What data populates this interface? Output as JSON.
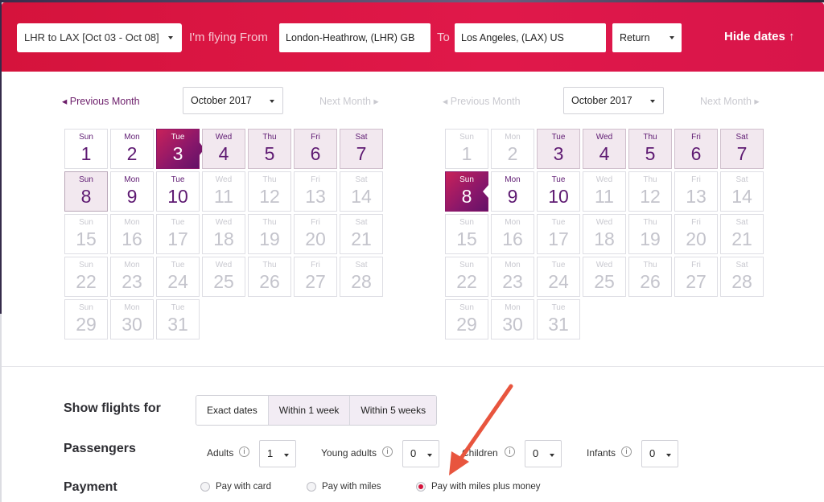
{
  "search_bar": {
    "route_select": "LHR to LAX [Oct 03 - Oct 08]",
    "from_label": "I'm flying From",
    "from_value": "London-Heathrow, (LHR) GB",
    "to_label": "To",
    "to_value": "Los Angeles, (LAX) US",
    "trip_type": "Return",
    "hide_dates": "Hide dates ↑"
  },
  "calendars": [
    {
      "prev_label": "◂ Previous Month",
      "month": "October 2017",
      "next_label": "Next Month ▸",
      "days": [
        {
          "dow": "Sun",
          "num": "1",
          "state": "normal"
        },
        {
          "dow": "Mon",
          "num": "2",
          "state": "normal"
        },
        {
          "dow": "Tue",
          "num": "3",
          "state": "selected-start"
        },
        {
          "dow": "Wed",
          "num": "4",
          "state": "range"
        },
        {
          "dow": "Thu",
          "num": "5",
          "state": "range"
        },
        {
          "dow": "Fri",
          "num": "6",
          "state": "range"
        },
        {
          "dow": "Sat",
          "num": "7",
          "state": "range"
        },
        {
          "dow": "Sun",
          "num": "8",
          "state": "range-end"
        },
        {
          "dow": "Mon",
          "num": "9",
          "state": "normal"
        },
        {
          "dow": "Tue",
          "num": "10",
          "state": "normal"
        },
        {
          "dow": "Wed",
          "num": "11",
          "state": "past"
        },
        {
          "dow": "Thu",
          "num": "12",
          "state": "past"
        },
        {
          "dow": "Fri",
          "num": "13",
          "state": "past"
        },
        {
          "dow": "Sat",
          "num": "14",
          "state": "past"
        },
        {
          "dow": "Sun",
          "num": "15",
          "state": "past"
        },
        {
          "dow": "Mon",
          "num": "16",
          "state": "past"
        },
        {
          "dow": "Tue",
          "num": "17",
          "state": "past"
        },
        {
          "dow": "Wed",
          "num": "18",
          "state": "past"
        },
        {
          "dow": "Thu",
          "num": "19",
          "state": "past"
        },
        {
          "dow": "Fri",
          "num": "20",
          "state": "past"
        },
        {
          "dow": "Sat",
          "num": "21",
          "state": "past"
        },
        {
          "dow": "Sun",
          "num": "22",
          "state": "past"
        },
        {
          "dow": "Mon",
          "num": "23",
          "state": "past"
        },
        {
          "dow": "Tue",
          "num": "24",
          "state": "past"
        },
        {
          "dow": "Wed",
          "num": "25",
          "state": "past"
        },
        {
          "dow": "Thu",
          "num": "26",
          "state": "past"
        },
        {
          "dow": "Fri",
          "num": "27",
          "state": "past"
        },
        {
          "dow": "Sat",
          "num": "28",
          "state": "past"
        },
        {
          "dow": "Sun",
          "num": "29",
          "state": "past"
        },
        {
          "dow": "Mon",
          "num": "30",
          "state": "past"
        },
        {
          "dow": "Tue",
          "num": "31",
          "state": "past"
        }
      ]
    },
    {
      "prev_label": "◂ Previous Month",
      "month": "October 2017",
      "next_label": "Next Month ▸",
      "days": [
        {
          "dow": "Sun",
          "num": "1",
          "state": "past"
        },
        {
          "dow": "Mon",
          "num": "2",
          "state": "past"
        },
        {
          "dow": "Tue",
          "num": "3",
          "state": "range"
        },
        {
          "dow": "Wed",
          "num": "4",
          "state": "range"
        },
        {
          "dow": "Thu",
          "num": "5",
          "state": "range"
        },
        {
          "dow": "Fri",
          "num": "6",
          "state": "range"
        },
        {
          "dow": "Sat",
          "num": "7",
          "state": "range"
        },
        {
          "dow": "Sun",
          "num": "8",
          "state": "selected-end"
        },
        {
          "dow": "Mon",
          "num": "9",
          "state": "normal"
        },
        {
          "dow": "Tue",
          "num": "10",
          "state": "normal"
        },
        {
          "dow": "Wed",
          "num": "11",
          "state": "past"
        },
        {
          "dow": "Thu",
          "num": "12",
          "state": "past"
        },
        {
          "dow": "Fri",
          "num": "13",
          "state": "past"
        },
        {
          "dow": "Sat",
          "num": "14",
          "state": "past"
        },
        {
          "dow": "Sun",
          "num": "15",
          "state": "past"
        },
        {
          "dow": "Mon",
          "num": "16",
          "state": "past"
        },
        {
          "dow": "Tue",
          "num": "17",
          "state": "past"
        },
        {
          "dow": "Wed",
          "num": "18",
          "state": "past"
        },
        {
          "dow": "Thu",
          "num": "19",
          "state": "past"
        },
        {
          "dow": "Fri",
          "num": "20",
          "state": "past"
        },
        {
          "dow": "Sat",
          "num": "21",
          "state": "past"
        },
        {
          "dow": "Sun",
          "num": "22",
          "state": "past"
        },
        {
          "dow": "Mon",
          "num": "23",
          "state": "past"
        },
        {
          "dow": "Tue",
          "num": "24",
          "state": "past"
        },
        {
          "dow": "Wed",
          "num": "25",
          "state": "past"
        },
        {
          "dow": "Thu",
          "num": "26",
          "state": "past"
        },
        {
          "dow": "Fri",
          "num": "27",
          "state": "past"
        },
        {
          "dow": "Sat",
          "num": "28",
          "state": "past"
        },
        {
          "dow": "Sun",
          "num": "29",
          "state": "past"
        },
        {
          "dow": "Mon",
          "num": "30",
          "state": "past"
        },
        {
          "dow": "Tue",
          "num": "31",
          "state": "past"
        }
      ]
    }
  ],
  "options": {
    "show_flights_label": "Show flights for",
    "show_flights_choices": [
      "Exact dates",
      "Within 1 week",
      "Within 5 weeks"
    ],
    "passengers_label": "Passengers",
    "adults_label": "Adults",
    "adults_value": "1",
    "young_adults_label": "Young adults",
    "young_adults_value": "0",
    "children_label": "Children",
    "children_value": "0",
    "infants_label": "Infants",
    "infants_value": "0",
    "info_glyph": "i",
    "payment_label": "Payment",
    "payment_choices": [
      "Pay with card",
      "Pay with miles",
      "Pay with miles plus money"
    ],
    "payment_selected_index": 2
  },
  "colors": {
    "brand_red": "#d5133c",
    "brand_purple": "#6b1c69",
    "annotation_arrow": "#e8553e"
  },
  "icons": {
    "dropdown": "chevron-down-icon",
    "info": "info-icon",
    "annotation": "arrow-icon"
  }
}
